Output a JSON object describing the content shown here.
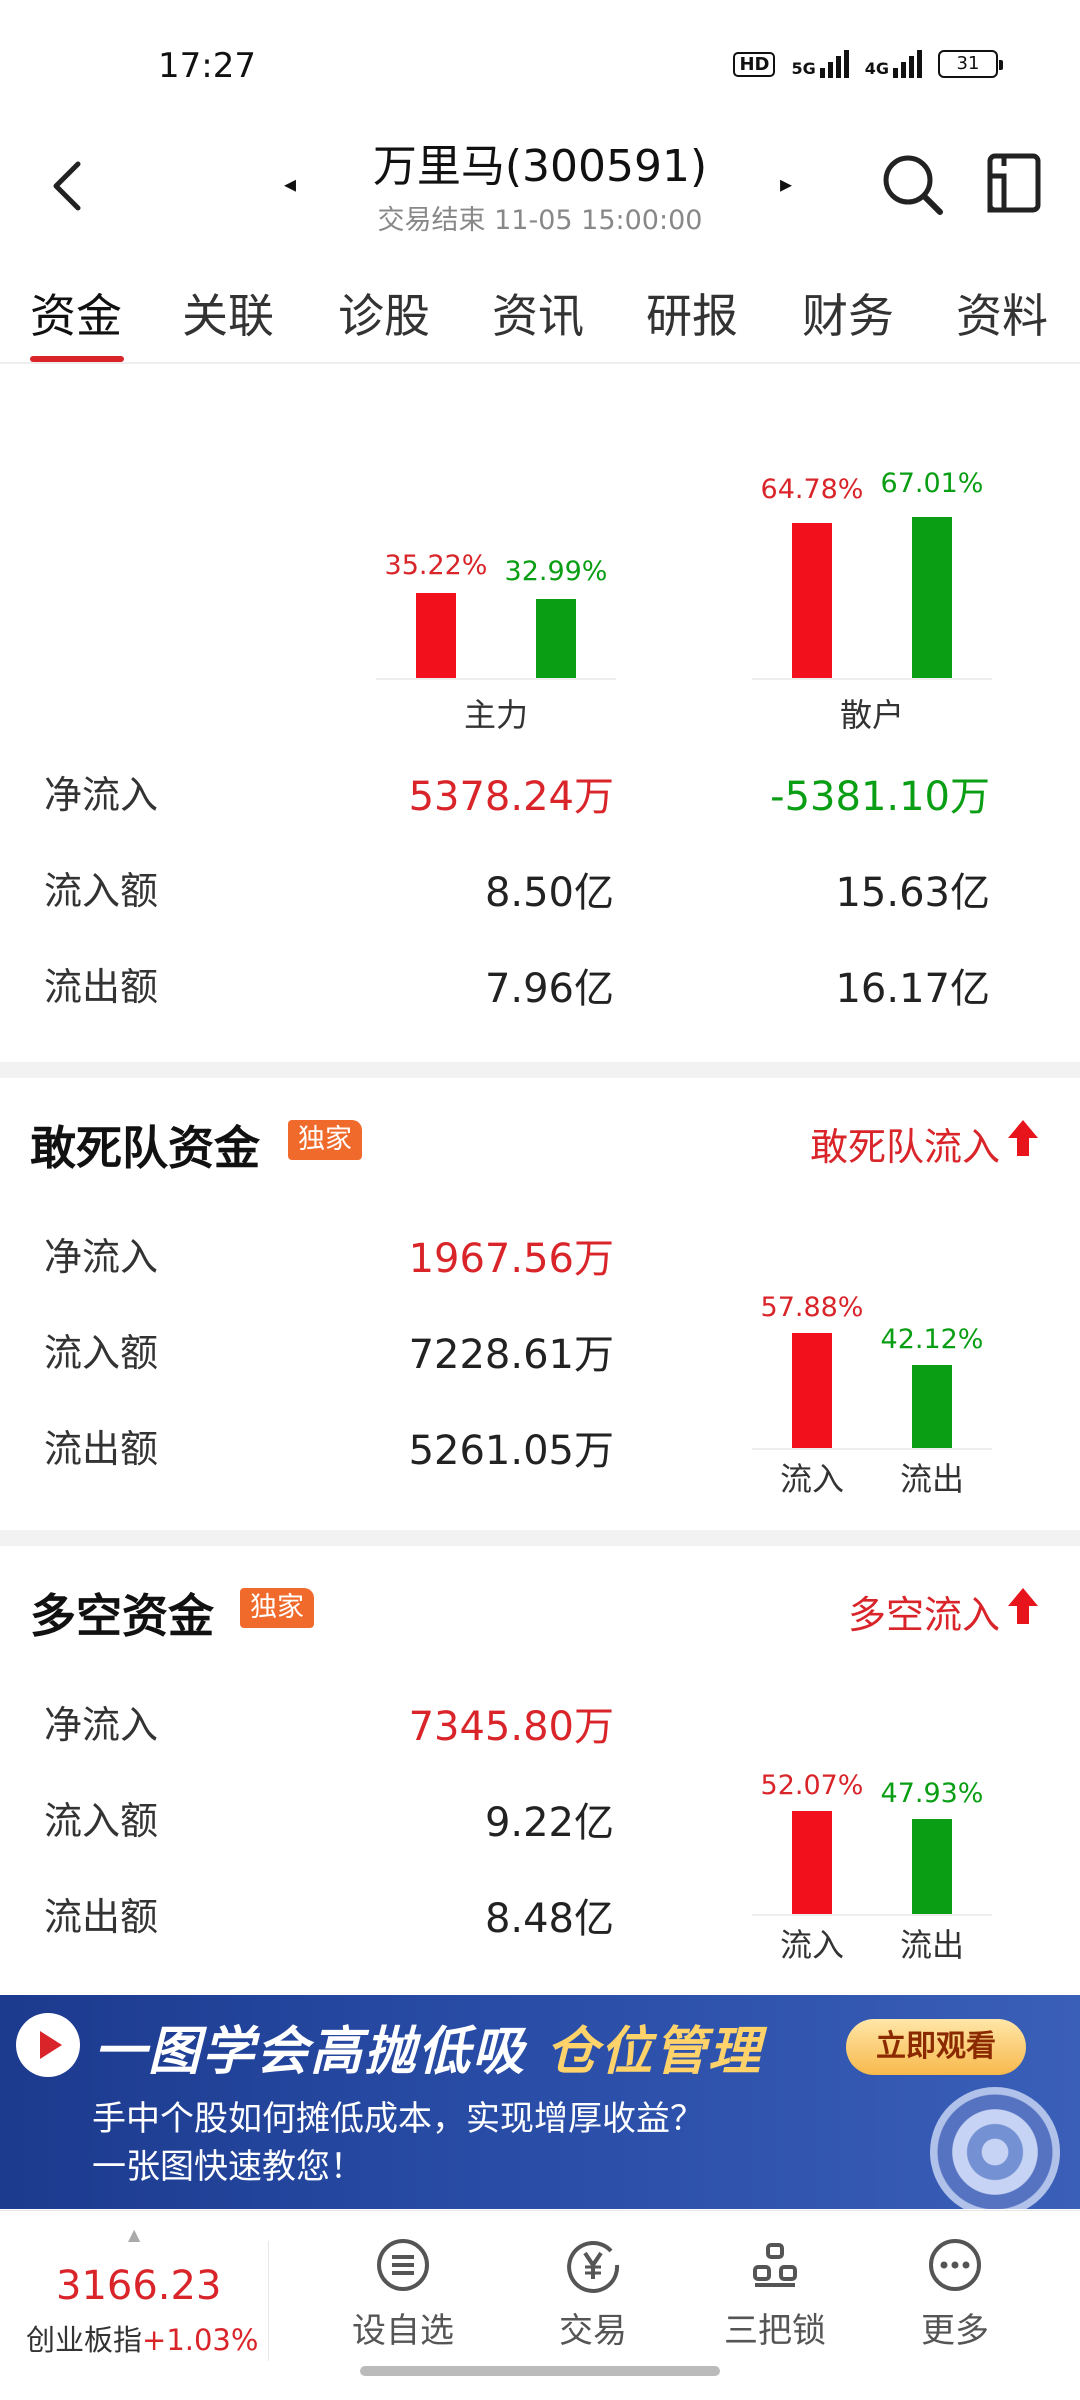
{
  "status_bar": {
    "time": "17:27",
    "hd": "HD",
    "net1": "5G",
    "net2": "4G",
    "battery": "31"
  },
  "header": {
    "title": "万里马(300591)",
    "subtitle": "交易结束 11-05 15:00:00"
  },
  "tabs": [
    "资金",
    "关联",
    "诊股",
    "资讯",
    "研报",
    "财务",
    "资料"
  ],
  "active_tab": "资金",
  "main_flow": {
    "groups": [
      {
        "label": "主力",
        "in_pct": "35.22%",
        "out_pct": "32.99%",
        "in_value": 35.22,
        "out_value": 32.99
      },
      {
        "label": "散户",
        "in_pct": "64.78%",
        "out_pct": "67.01%",
        "in_value": 64.78,
        "out_value": 67.01
      }
    ],
    "rows": [
      {
        "label": "净流入",
        "main": "5378.24万",
        "retail": "-5381.10万"
      },
      {
        "label": "流入额",
        "main": "8.50亿",
        "retail": "15.63亿"
      },
      {
        "label": "流出额",
        "main": "7.96亿",
        "retail": "16.17亿"
      }
    ]
  },
  "dare_fund": {
    "title": "敢死队资金",
    "badge": "独家",
    "link": "敢死队流入",
    "rows": [
      {
        "label": "净流入",
        "value": "1967.56万"
      },
      {
        "label": "流入额",
        "value": "7228.61万"
      },
      {
        "label": "流出额",
        "value": "5261.05万"
      }
    ],
    "chart": {
      "in_pct": "57.88%",
      "out_pct": "42.12%",
      "in_value": 57.88,
      "out_value": 42.12,
      "in_label": "流入",
      "out_label": "流出"
    }
  },
  "long_short_fund": {
    "title": "多空资金",
    "badge": "独家",
    "link": "多空流入",
    "rows": [
      {
        "label": "净流入",
        "value": "7345.80万"
      },
      {
        "label": "流入额",
        "value": "9.22亿"
      },
      {
        "label": "流出额",
        "value": "8.48亿"
      }
    ],
    "chart": {
      "in_pct": "52.07%",
      "out_pct": "47.93%",
      "in_value": 52.07,
      "out_value": 47.93,
      "in_label": "流入",
      "out_label": "流出"
    }
  },
  "banner": {
    "headline_a": "一图学会高抛低吸",
    "headline_b": "仓位管理",
    "button": "立即观看",
    "line1": "手中个股如何摊低成本，实现增厚收益？",
    "line2": "一张图快速教您！"
  },
  "bottom_bar": {
    "index_value": "3166.23",
    "index_name": "创业板指",
    "index_change": "+1.03%",
    "nav": [
      {
        "label": "设自选",
        "icon": "list-circle-icon"
      },
      {
        "label": "交易",
        "icon": "yen-circle-icon"
      },
      {
        "label": "三把锁",
        "icon": "locks-icon"
      },
      {
        "label": "更多",
        "icon": "more-dots-icon"
      }
    ]
  },
  "colors": {
    "up": "#d9252a",
    "down": "#0a9e14",
    "bar_red": "#f1101c",
    "badge": "#f06a2b"
  }
}
